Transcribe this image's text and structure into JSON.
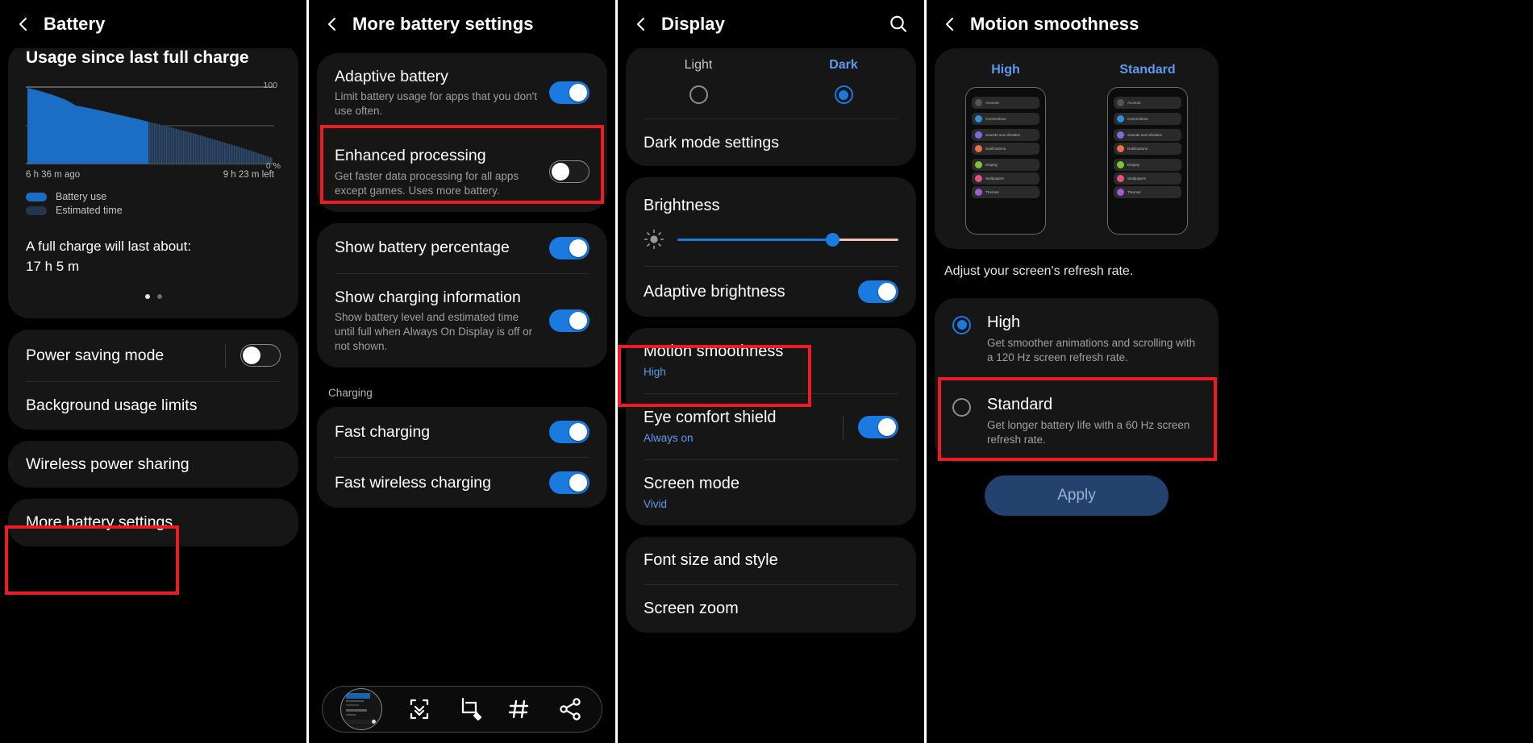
{
  "panels": {
    "battery": {
      "header": {
        "title": "Battery",
        "back_icon": "back-chevron-icon"
      },
      "usage_heading": "Usage since last full charge",
      "chart": {
        "y_top_label": "100",
        "y_bottom_label": "0 %",
        "time_left_label": "6 h 36 m ago",
        "time_right_label": "9 h 23 m left",
        "legend": [
          {
            "label": "Battery use",
            "color": "#1a6fc4"
          },
          {
            "label": "Estimated time",
            "color": "#24364f"
          }
        ]
      },
      "full_charge_label": "A full charge will last about:",
      "full_charge_value": "17 h 5 m",
      "page_dots": {
        "count": 2,
        "active_index": 0
      },
      "rows": [
        {
          "title": "Power saving mode",
          "toggle": "off"
        },
        {
          "title": "Background usage limits"
        },
        {
          "title": "Wireless power sharing"
        },
        {
          "title": "More battery settings"
        }
      ]
    },
    "more_battery": {
      "header": {
        "title": "More battery settings",
        "back_icon": "back-chevron-icon"
      },
      "rows": [
        {
          "title": "Adaptive battery",
          "sub": "Limit battery usage for apps that you don't use often.",
          "toggle": "on"
        },
        {
          "title": "Enhanced processing",
          "sub": "Get faster data processing for all apps except games. Uses more battery.",
          "toggle": "off",
          "highlighted": true
        },
        {
          "title": "Show battery percentage",
          "toggle": "on"
        },
        {
          "title": "Show charging information",
          "sub": "Show battery level and estimated time until full when Always On Display is off or not shown.",
          "toggle": "on"
        }
      ],
      "charging_section_label": "Charging",
      "charging_rows": [
        {
          "title": "Fast charging",
          "toggle": "on"
        },
        {
          "title": "Fast wireless charging",
          "toggle": "on"
        }
      ],
      "toolbar": {
        "thumbnail": "screenshot-thumbnail",
        "icons": [
          "scroll-capture-icon",
          "crop-edit-icon",
          "tags-icon",
          "share-icon"
        ]
      }
    },
    "display": {
      "header": {
        "title": "Display",
        "back_icon": "back-chevron-icon",
        "search_icon": "search-icon"
      },
      "modes": [
        {
          "label": "Light",
          "selected": false
        },
        {
          "label": "Dark",
          "selected": true
        }
      ],
      "dark_mode_settings": "Dark mode settings",
      "brightness": {
        "title": "Brightness",
        "icon": "brightness-sun-icon",
        "value_percent": 70
      },
      "rows": [
        {
          "title": "Adaptive brightness",
          "toggle": "on"
        },
        {
          "title": "Motion smoothness",
          "sub": "High",
          "highlighted": true
        },
        {
          "title": "Eye comfort shield",
          "sub": "Always on",
          "toggle": "on"
        },
        {
          "title": "Screen mode",
          "sub": "Vivid"
        },
        {
          "title": "Font size and style"
        },
        {
          "title": "Screen zoom"
        }
      ]
    },
    "motion": {
      "header": {
        "title": "Motion smoothness",
        "back_icon": "back-chevron-icon"
      },
      "previews": [
        {
          "label": "High",
          "items": [
            {
              "text": "Account",
              "color": "none"
            },
            {
              "text": "Connections",
              "color": "#2e8fd8"
            },
            {
              "text": "Sounds and vibration",
              "color": "#7b6ddb"
            },
            {
              "text": "Notifications",
              "color": "#e8704a"
            },
            {
              "text": "Display",
              "color": "#7ec43a"
            },
            {
              "text": "Wallpapers",
              "color": "#e0547f"
            },
            {
              "text": "Themes",
              "color": "#a45ad8"
            }
          ]
        },
        {
          "label": "Standard",
          "items": [
            {
              "text": "Account",
              "color": "none"
            },
            {
              "text": "Connections",
              "color": "#2e8fd8"
            },
            {
              "text": "Sounds and vibration",
              "color": "#7b6ddb"
            },
            {
              "text": "Notifications",
              "color": "#e8704a"
            },
            {
              "text": "Display",
              "color": "#7ec43a"
            },
            {
              "text": "Wallpapers",
              "color": "#e0547f"
            },
            {
              "text": "Themes",
              "color": "#a45ad8"
            }
          ]
        }
      ],
      "description": "Adjust your screen's refresh rate.",
      "options": [
        {
          "title": "High",
          "sub": "Get smoother animations and scrolling with a 120 Hz screen refresh rate.",
          "selected": true
        },
        {
          "title": "Standard",
          "sub": "Get longer battery life with a 60 Hz screen refresh rate.",
          "selected": false,
          "highlighted": true
        }
      ],
      "apply_button": "Apply"
    }
  },
  "colors": {
    "accent_blue": "#1a7ae0",
    "link_blue": "#5e9bf0",
    "highlight_red": "#ee1b24",
    "card_bg": "#161616",
    "page_bg": "#000000"
  }
}
